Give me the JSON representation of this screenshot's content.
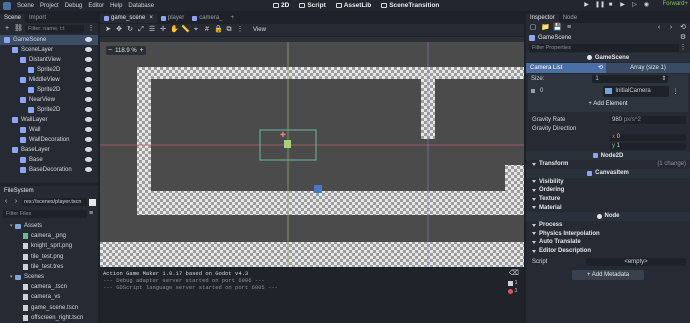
{
  "menubar": {
    "items": [
      "Scene",
      "Project",
      "Debug",
      "Editor",
      "Help",
      "Database"
    ],
    "workspaces": [
      "2D",
      "Script",
      "AssetLib",
      "SceneTransition"
    ],
    "renderer": "Forward+"
  },
  "scene_panel": {
    "tabs": [
      "Scene",
      "Import"
    ],
    "filter_placeholder": "Filter: name, t:t",
    "nodes": [
      {
        "label": "GameScene",
        "indent": 0,
        "color": "#8da5f3",
        "selected": true
      },
      {
        "label": "SceneLayer",
        "indent": 1,
        "color": "#8da5f3"
      },
      {
        "label": "DistantView",
        "indent": 2,
        "color": "#8da5f3"
      },
      {
        "label": "Sprite2D",
        "indent": 3,
        "color": "#8da5f3"
      },
      {
        "label": "MiddleView",
        "indent": 2,
        "color": "#8da5f3"
      },
      {
        "label": "Sprite2D",
        "indent": 3,
        "color": "#8da5f3"
      },
      {
        "label": "NearView",
        "indent": 2,
        "color": "#8da5f3"
      },
      {
        "label": "Sprite2D",
        "indent": 3,
        "color": "#8da5f3"
      },
      {
        "label": "WallLayer",
        "indent": 1,
        "color": "#8da5f3"
      },
      {
        "label": "Wall",
        "indent": 2,
        "color": "#8da5f3"
      },
      {
        "label": "WallDecoration",
        "indent": 2,
        "color": "#8da5f3"
      },
      {
        "label": "BaseLayer",
        "indent": 1,
        "color": "#8da5f3"
      },
      {
        "label": "Base",
        "indent": 2,
        "color": "#8da5f3"
      },
      {
        "label": "BaseDecoration",
        "indent": 2,
        "color": "#8da5f3"
      }
    ]
  },
  "filesystem": {
    "title": "FileSystem",
    "path": "res://scenes/player.tscn",
    "filter_placeholder": "Filter Files",
    "items": [
      {
        "label": "Assets",
        "type": "folder",
        "indent": 1
      },
      {
        "label": "camera_.png",
        "type": "image",
        "indent": 2
      },
      {
        "label": "knight_sprt.png",
        "type": "file",
        "indent": 2
      },
      {
        "label": "tile_test.png",
        "type": "file",
        "indent": 2
      },
      {
        "label": "tile_test.tres",
        "type": "file",
        "indent": 2
      },
      {
        "label": "Scenes",
        "type": "folder",
        "indent": 1
      },
      {
        "label": "camera_.tscn",
        "type": "file",
        "indent": 2
      },
      {
        "label": "camera_vs",
        "type": "file",
        "indent": 2
      },
      {
        "label": "game_scene.tscn",
        "type": "file",
        "indent": 2
      },
      {
        "label": "offscreen_right.tscn",
        "type": "file",
        "indent": 2
      }
    ]
  },
  "editor_tabs": [
    "game_scene",
    "player",
    "camera_"
  ],
  "viewport": {
    "zoom": "118.9 %",
    "view_menu": "View"
  },
  "output": {
    "lines": [
      "Action Game Maker 1.0.17 based on Godot v4.3",
      "--- Debug adapter server started on port 6006 ---",
      "--- GDScript language server started on port 6005 ---"
    ],
    "badges": [
      "1",
      "1"
    ]
  },
  "inspector": {
    "tabs": [
      "Inspector",
      "Node"
    ],
    "node_name": "GameScene",
    "filter_placeholder": "Filter Properties",
    "section_title": "GameScene",
    "camera_list": {
      "label": "Camera List",
      "type": "Array (size 1)",
      "size_label": "Size:",
      "size_value": "1",
      "index": "0",
      "item": "InitialCamera",
      "add_label": "+ Add Element"
    },
    "gravity_rate_label": "Gravity Rate",
    "gravity_rate_value": "980",
    "gravity_rate_unit": "px/s^2",
    "gravity_dir_label": "Gravity Direction",
    "gravity_x": "0",
    "gravity_y": "1",
    "node2d_section": "Node2D",
    "transform_label": "Transform",
    "transform_badge": "(1 change)",
    "canvas_section": "CanvasItem",
    "canvas_cats": [
      "Visibility",
      "Ordering",
      "Texture",
      "Material"
    ],
    "node_section": "Node",
    "node_cats": [
      "Process",
      "Physics Interpolation",
      "Auto Translate",
      "Editor Description"
    ],
    "script_label": "Script",
    "script_value": "<empty>",
    "add_metadata": "+ Add Metadata"
  },
  "colors": {
    "accent": "#4a6fa5",
    "selection": "#3d4d66",
    "viewport_bg": "#4b4b4b",
    "camera_rect": "#6fd3b8"
  }
}
